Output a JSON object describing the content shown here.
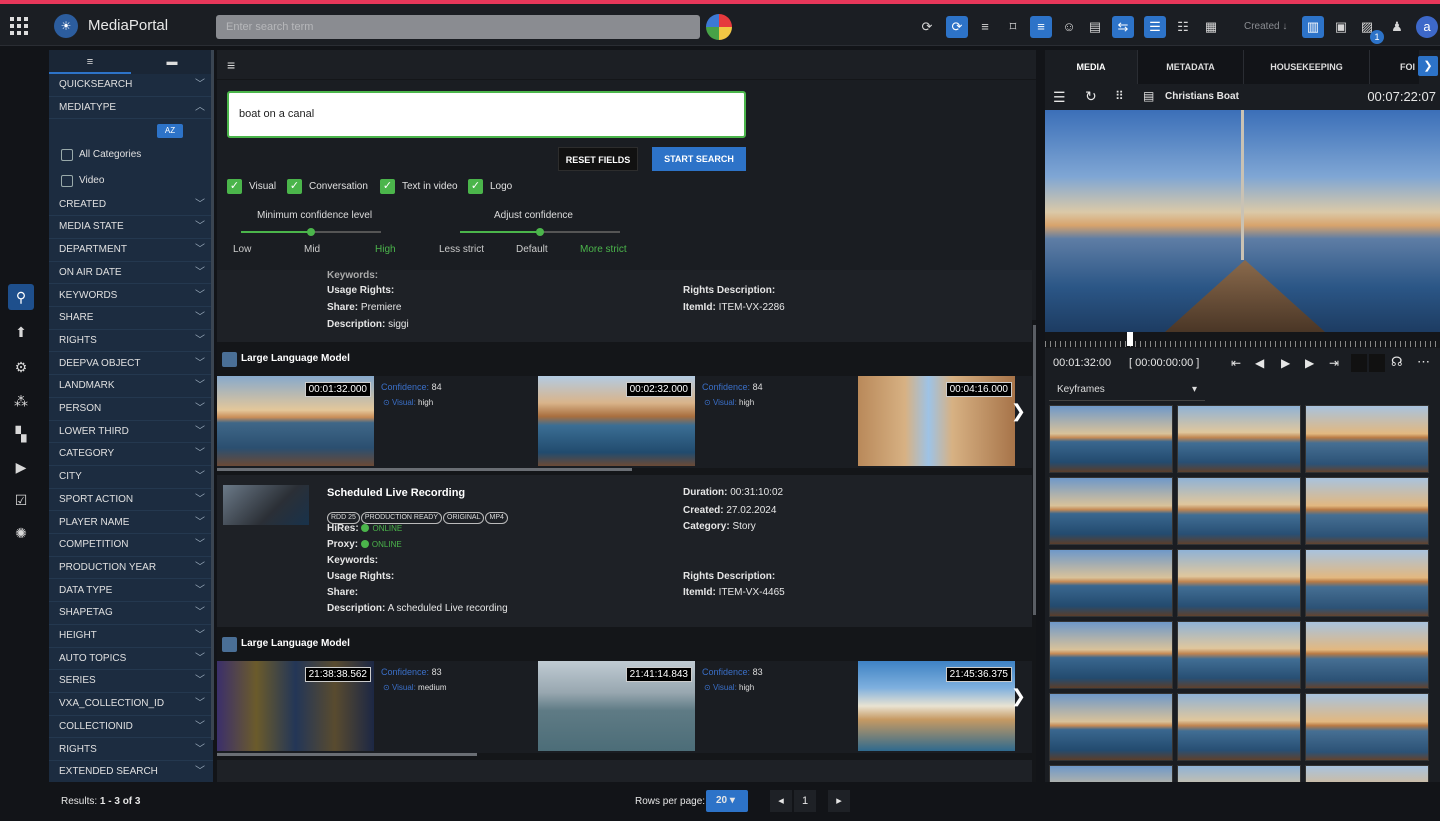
{
  "app": {
    "brand": "MediaPortal",
    "search_placeholder": "Enter search term",
    "sort_label": "Created",
    "avatar_letter": "a",
    "notification_count": "1"
  },
  "filters": {
    "tabs": [
      "filter",
      "folder"
    ],
    "rows": [
      "QUICKSEARCH",
      "MEDIATYPE",
      "CREATED",
      "MEDIA STATE",
      "DEPARTMENT",
      "ON AIR DATE",
      "KEYWORDS",
      "SHARE",
      "RIGHTS",
      "DEEPVA OBJECT",
      "LANDMARK",
      "PERSON",
      "LOWER THIRD",
      "CATEGORY",
      "CITY",
      "SPORT ACTION",
      "PLAYER NAME",
      "COMPETITION",
      "PRODUCTION YEAR",
      "DATA TYPE",
      "SHAPETAG",
      "HEIGHT",
      "AUTO TOPICS",
      "SERIES",
      "VXA_COLLECTION_ID",
      "COLLECTIONID",
      "RIGHTS",
      "EXTENDED SEARCH"
    ],
    "sort_button": "AZ",
    "mediatype_options": [
      "All Categories",
      "Video"
    ]
  },
  "query": {
    "text": "boat on a canal",
    "reset_label": "RESET FIELDS",
    "start_label": "START SEARCH",
    "checks": [
      "Visual",
      "Conversation",
      "Text in video",
      "Logo"
    ],
    "confidence": {
      "title": "Minimum confidence level",
      "labels": [
        "Low",
        "Mid",
        "High"
      ],
      "level": 0.5
    },
    "adjust": {
      "title": "Adjust confidence",
      "labels": [
        "Less strict",
        "Default",
        "More strict"
      ],
      "level": 0.5
    }
  },
  "results": {
    "card1": {
      "keywords_label": "Keywords:",
      "usage_label": "Usage Rights:",
      "share_label": "Share:",
      "share_value": "Premiere",
      "desc_label": "Description:",
      "desc_value": "siggi",
      "rights_desc_label": "Rights Description:",
      "itemid_label": "ItemId:",
      "itemid_value": "ITEM-VX-2286"
    },
    "llm1": {
      "title": "Large Language Model",
      "items": [
        {
          "time": "00:01:32.000",
          "conf_label": "Confidence:",
          "conf": "84",
          "vis_label": "Visual:",
          "vis": "high"
        },
        {
          "time": "00:02:32.000",
          "conf_label": "Confidence:",
          "conf": "84",
          "vis_label": "Visual:",
          "vis": "high"
        },
        {
          "time": "00:04:16.000",
          "conf_label": "",
          "conf": "",
          "vis_label": "",
          "vis": ""
        }
      ]
    },
    "card2": {
      "title": "Scheduled Live Recording",
      "tags": [
        "RDD 25",
        "PRODUCTION READY",
        "ORIGINAL",
        "MP4"
      ],
      "hires_label": "HiRes:",
      "hires": "ONLINE",
      "proxy_label": "Proxy:",
      "proxy": "ONLINE",
      "keywords_label": "Keywords:",
      "usage_label": "Usage Rights:",
      "share_label": "Share:",
      "desc_label": "Description:",
      "desc_value": "A scheduled Live recording",
      "duration_label": "Duration:",
      "duration": "00:31:10:02",
      "created_label": "Created:",
      "created": "27.02.2024",
      "category_label": "Category:",
      "category": "Story",
      "rights_desc_label": "Rights Description:",
      "itemid_label": "ItemId:",
      "itemid_value": "ITEM-VX-4465"
    },
    "llm2": {
      "title": "Large Language Model",
      "items": [
        {
          "time": "21:38:38.562",
          "conf_label": "Confidence:",
          "conf": "83",
          "vis_label": "Visual:",
          "vis": "medium"
        },
        {
          "time": "21:41:14.843",
          "conf_label": "Confidence:",
          "conf": "83",
          "vis_label": "Visual:",
          "vis": "high"
        },
        {
          "time": "21:45:36.375",
          "conf_label": "",
          "conf": "",
          "vis_label": "",
          "vis": ""
        }
      ]
    }
  },
  "footer": {
    "results_label": "Results:",
    "results_value": "1 - 3 of 3",
    "rows_label": "Rows per page:",
    "rows_value": "20",
    "page": "1"
  },
  "player": {
    "tabs": [
      "MEDIA",
      "METADATA",
      "HOUSEKEEPING",
      "FOI"
    ],
    "title": "Christians Boat",
    "duration": "00:07:22:07",
    "current_time": "00:01:32:00",
    "in_point": "00:00:00:00",
    "keyframes_label": "Keyframes"
  },
  "colors": {
    "accent": "#2d73c8",
    "green": "#4bb54b",
    "brand_red": "#e8375a"
  }
}
